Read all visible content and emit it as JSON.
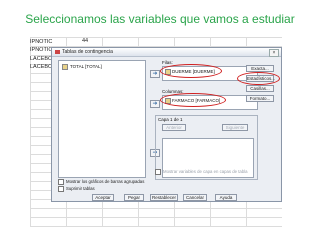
{
  "heading": "Seleccionamos las variables que vamos a estudiar",
  "spreadsheet": {
    "row_labels": [
      "IPNOTIC",
      "IPNOTIC",
      "LACEBO",
      "LACEBO"
    ],
    "cell_value": "44"
  },
  "dialog": {
    "title": "Tablas de contingencia",
    "close": "×",
    "source_list": [
      "TOTAL [TOTAL]"
    ],
    "rows_label": "Filas:",
    "rows_value": "DUERME [DUERME]",
    "columns_label": "Columnas:",
    "columns_value": "FARMACO [FARMACO]",
    "layer_label": "Capa 1 de 1",
    "layer_prev": "Anterior",
    "layer_next": "Siguiente",
    "layer_checkbox": "Mostrar variables de capa en capas de tabla",
    "side_buttons": [
      "Exacta...",
      "Estadísticos...",
      "Casillas...",
      "Formato..."
    ],
    "check_clustered": "Mostrar los gráficos de barras agrupadas",
    "check_suppress": "Suprimir tablas",
    "footer_buttons": [
      "Aceptar",
      "Pegar",
      "Restablecer",
      "Cancelar",
      "Ayuda"
    ]
  },
  "colors": {
    "heading": "#2aa44a",
    "highlight_ring": "#d02020"
  },
  "icons": [
    "table-icon",
    "arrow-right-icon",
    "variable-icon",
    "close-icon"
  ]
}
